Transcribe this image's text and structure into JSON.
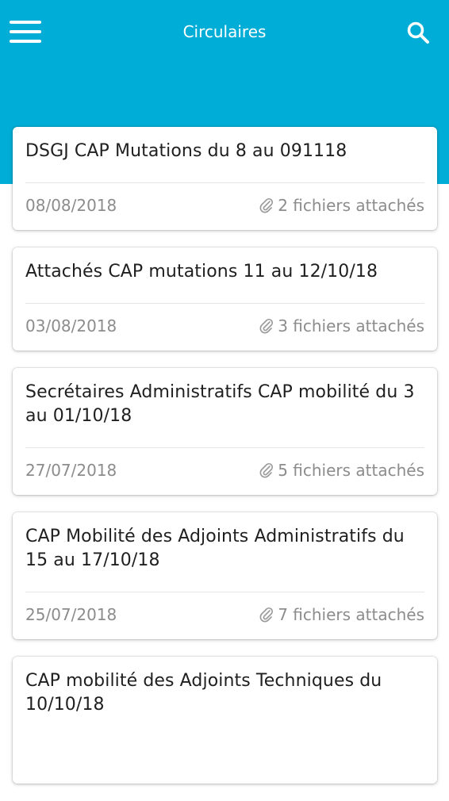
{
  "colors": {
    "header": "#00add6",
    "card_title": "#1f1f1f",
    "meta": "#8c8c8c"
  },
  "header": {
    "title": "Circulaires",
    "menu_icon": "hamburger-menu-icon",
    "search_icon": "search-icon"
  },
  "circulaires": [
    {
      "title": "DSGJ CAP Mutations du 8 au 091118",
      "date": "08/08/2018",
      "attachments": "2 fichiers attachés"
    },
    {
      "title": "Attachés CAP mutations 11 au 12/10/18",
      "date": "03/08/2018",
      "attachments": "3 fichiers attachés"
    },
    {
      "title": "Secrétaires Administratifs CAP mobilité du 3 au 01/10/18",
      "date": "27/07/2018",
      "attachments": "5 fichiers attachés"
    },
    {
      "title": "CAP Mobilité des Adjoints Administratifs du 15 au 17/10/18",
      "date": "25/07/2018",
      "attachments": "7 fichiers attachés"
    },
    {
      "title": "CAP mobilité des Adjoints Techniques du 10/10/18",
      "date": "",
      "attachments": ""
    }
  ]
}
